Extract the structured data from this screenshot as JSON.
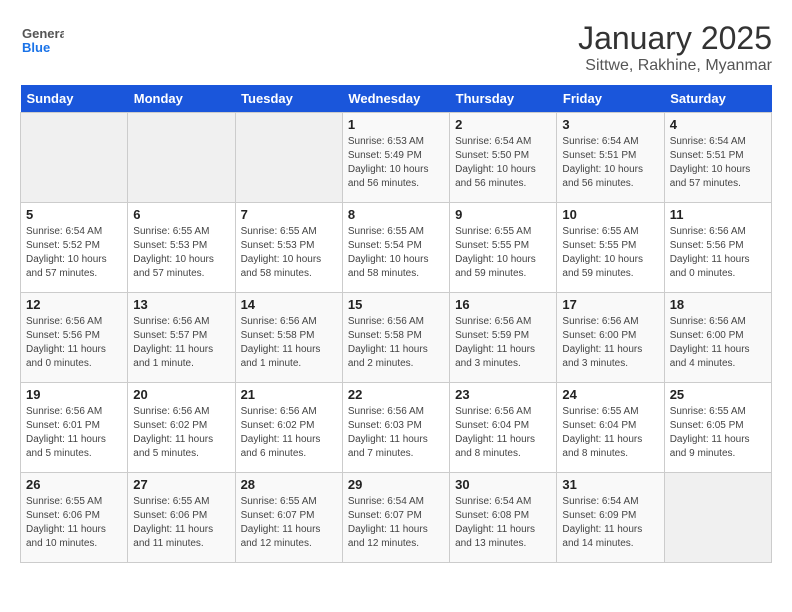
{
  "header": {
    "logo_line1": "General",
    "logo_line2": "Blue",
    "title": "January 2025",
    "subtitle": "Sittwe, Rakhine, Myanmar"
  },
  "days_of_week": [
    "Sunday",
    "Monday",
    "Tuesday",
    "Wednesday",
    "Thursday",
    "Friday",
    "Saturday"
  ],
  "weeks": [
    [
      {
        "day": "",
        "info": ""
      },
      {
        "day": "",
        "info": ""
      },
      {
        "day": "",
        "info": ""
      },
      {
        "day": "1",
        "info": "Sunrise: 6:53 AM\nSunset: 5:49 PM\nDaylight: 10 hours\nand 56 minutes."
      },
      {
        "day": "2",
        "info": "Sunrise: 6:54 AM\nSunset: 5:50 PM\nDaylight: 10 hours\nand 56 minutes."
      },
      {
        "day": "3",
        "info": "Sunrise: 6:54 AM\nSunset: 5:51 PM\nDaylight: 10 hours\nand 56 minutes."
      },
      {
        "day": "4",
        "info": "Sunrise: 6:54 AM\nSunset: 5:51 PM\nDaylight: 10 hours\nand 57 minutes."
      }
    ],
    [
      {
        "day": "5",
        "info": "Sunrise: 6:54 AM\nSunset: 5:52 PM\nDaylight: 10 hours\nand 57 minutes."
      },
      {
        "day": "6",
        "info": "Sunrise: 6:55 AM\nSunset: 5:53 PM\nDaylight: 10 hours\nand 57 minutes."
      },
      {
        "day": "7",
        "info": "Sunrise: 6:55 AM\nSunset: 5:53 PM\nDaylight: 10 hours\nand 58 minutes."
      },
      {
        "day": "8",
        "info": "Sunrise: 6:55 AM\nSunset: 5:54 PM\nDaylight: 10 hours\nand 58 minutes."
      },
      {
        "day": "9",
        "info": "Sunrise: 6:55 AM\nSunset: 5:55 PM\nDaylight: 10 hours\nand 59 minutes."
      },
      {
        "day": "10",
        "info": "Sunrise: 6:55 AM\nSunset: 5:55 PM\nDaylight: 10 hours\nand 59 minutes."
      },
      {
        "day": "11",
        "info": "Sunrise: 6:56 AM\nSunset: 5:56 PM\nDaylight: 11 hours\nand 0 minutes."
      }
    ],
    [
      {
        "day": "12",
        "info": "Sunrise: 6:56 AM\nSunset: 5:56 PM\nDaylight: 11 hours\nand 0 minutes."
      },
      {
        "day": "13",
        "info": "Sunrise: 6:56 AM\nSunset: 5:57 PM\nDaylight: 11 hours\nand 1 minute."
      },
      {
        "day": "14",
        "info": "Sunrise: 6:56 AM\nSunset: 5:58 PM\nDaylight: 11 hours\nand 1 minute."
      },
      {
        "day": "15",
        "info": "Sunrise: 6:56 AM\nSunset: 5:58 PM\nDaylight: 11 hours\nand 2 minutes."
      },
      {
        "day": "16",
        "info": "Sunrise: 6:56 AM\nSunset: 5:59 PM\nDaylight: 11 hours\nand 3 minutes."
      },
      {
        "day": "17",
        "info": "Sunrise: 6:56 AM\nSunset: 6:00 PM\nDaylight: 11 hours\nand 3 minutes."
      },
      {
        "day": "18",
        "info": "Sunrise: 6:56 AM\nSunset: 6:00 PM\nDaylight: 11 hours\nand 4 minutes."
      }
    ],
    [
      {
        "day": "19",
        "info": "Sunrise: 6:56 AM\nSunset: 6:01 PM\nDaylight: 11 hours\nand 5 minutes."
      },
      {
        "day": "20",
        "info": "Sunrise: 6:56 AM\nSunset: 6:02 PM\nDaylight: 11 hours\nand 5 minutes."
      },
      {
        "day": "21",
        "info": "Sunrise: 6:56 AM\nSunset: 6:02 PM\nDaylight: 11 hours\nand 6 minutes."
      },
      {
        "day": "22",
        "info": "Sunrise: 6:56 AM\nSunset: 6:03 PM\nDaylight: 11 hours\nand 7 minutes."
      },
      {
        "day": "23",
        "info": "Sunrise: 6:56 AM\nSunset: 6:04 PM\nDaylight: 11 hours\nand 8 minutes."
      },
      {
        "day": "24",
        "info": "Sunrise: 6:55 AM\nSunset: 6:04 PM\nDaylight: 11 hours\nand 8 minutes."
      },
      {
        "day": "25",
        "info": "Sunrise: 6:55 AM\nSunset: 6:05 PM\nDaylight: 11 hours\nand 9 minutes."
      }
    ],
    [
      {
        "day": "26",
        "info": "Sunrise: 6:55 AM\nSunset: 6:06 PM\nDaylight: 11 hours\nand 10 minutes."
      },
      {
        "day": "27",
        "info": "Sunrise: 6:55 AM\nSunset: 6:06 PM\nDaylight: 11 hours\nand 11 minutes."
      },
      {
        "day": "28",
        "info": "Sunrise: 6:55 AM\nSunset: 6:07 PM\nDaylight: 11 hours\nand 12 minutes."
      },
      {
        "day": "29",
        "info": "Sunrise: 6:54 AM\nSunset: 6:07 PM\nDaylight: 11 hours\nand 12 minutes."
      },
      {
        "day": "30",
        "info": "Sunrise: 6:54 AM\nSunset: 6:08 PM\nDaylight: 11 hours\nand 13 minutes."
      },
      {
        "day": "31",
        "info": "Sunrise: 6:54 AM\nSunset: 6:09 PM\nDaylight: 11 hours\nand 14 minutes."
      },
      {
        "day": "",
        "info": ""
      }
    ]
  ]
}
